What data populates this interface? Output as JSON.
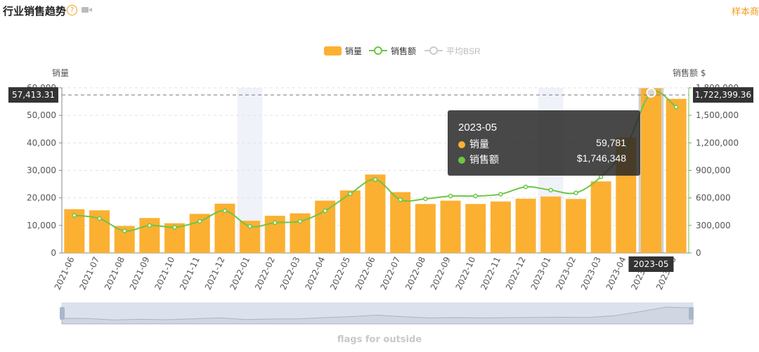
{
  "header": {
    "title": "行业销售趋势",
    "help_glyph": "?",
    "right_link": "样本商"
  },
  "chart_data": {
    "type": "bar",
    "categories": [
      "2021-06",
      "2021-07",
      "2021-08",
      "2021-09",
      "2021-10",
      "2021-11",
      "2021-12",
      "2022-01",
      "2022-02",
      "2022-03",
      "2022-04",
      "2022-05",
      "2022-06",
      "2022-07",
      "2022-08",
      "2022-09",
      "2022-10",
      "2022-11",
      "2022-12",
      "2023-01",
      "2023-02",
      "2023-03",
      "2023-04",
      "2023-05",
      "2023-06"
    ],
    "series": [
      {
        "name": "销量",
        "type": "bar",
        "axis": "left",
        "color": "#fbb032",
        "values": [
          15900,
          15500,
          9800,
          12700,
          10800,
          14200,
          17900,
          11700,
          13500,
          14400,
          19000,
          22700,
          28500,
          22100,
          17800,
          19000,
          17800,
          18700,
          19700,
          20500,
          19600,
          26000,
          42000,
          59781,
          56000
        ]
      },
      {
        "name": "销售额",
        "type": "line",
        "axis": "right",
        "color": "#6cc644",
        "values": [
          410000,
          375000,
          240000,
          300000,
          280000,
          345000,
          460000,
          290000,
          330000,
          345000,
          460000,
          645000,
          800000,
          580000,
          590000,
          620000,
          620000,
          640000,
          720000,
          685000,
          655000,
          830000,
          1150000,
          1746348,
          1590000
        ]
      },
      {
        "name": "平均BSR",
        "type": "line",
        "color": "#cccccc",
        "values": []
      }
    ],
    "y_left": {
      "label": "销量",
      "min": 0,
      "max": 60000,
      "ticks": [
        "0",
        "10,000",
        "20,000",
        "30,000",
        "40,000",
        "50,000",
        "60,000"
      ]
    },
    "y_right": {
      "label": "销售额 $",
      "min": 0,
      "max": 1800000,
      "ticks": [
        "0",
        "300,000",
        "600,000",
        "900,000",
        "1,200,000",
        "1,500,000",
        "1,800,000"
      ]
    },
    "highlighted_categories": [
      "2022-01",
      "2023-01"
    ],
    "hover": {
      "category": "2023-05",
      "left_axis_pointer": "57,413.31",
      "right_axis_pointer": "1,722,399.36",
      "tooltip": {
        "title": "2023-05",
        "rows": [
          {
            "name": "销量",
            "value": "59,781",
            "color": "#fbb032"
          },
          {
            "name": "销售额",
            "value": "$1,746,348",
            "color": "#6cc644"
          }
        ]
      }
    },
    "legend_position": "top-center",
    "grid": "dashed horizontal"
  },
  "footer": {
    "text": "flags for outside"
  }
}
